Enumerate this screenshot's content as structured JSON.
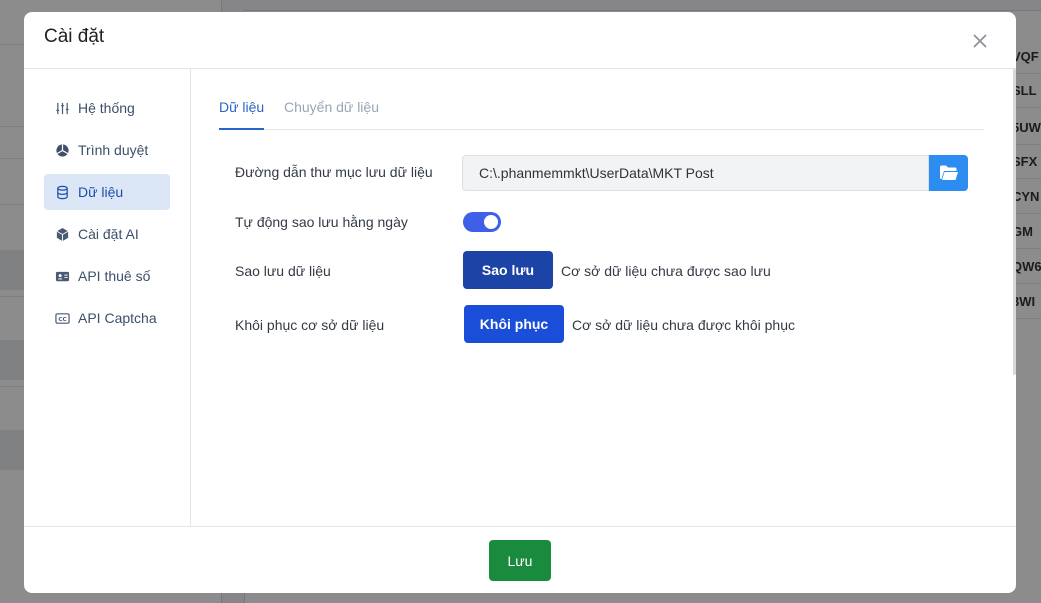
{
  "background": {
    "table_cells": [
      "VQF",
      "SLL",
      "5UW",
      "SFX",
      "CYN",
      "GM",
      "QW6",
      "3WI"
    ]
  },
  "modal": {
    "title": "Cài đặt",
    "close_icon": "close-icon"
  },
  "sidebar": {
    "items": [
      {
        "label": "Hệ thống",
        "icon": "sliders-icon"
      },
      {
        "label": "Trình duyệt",
        "icon": "browser-globe-icon"
      },
      {
        "label": "Dữ liệu",
        "icon": "database-icon",
        "active": true
      },
      {
        "label": "Cài đặt AI",
        "icon": "ai-cube-icon"
      },
      {
        "label": "API thuê số",
        "icon": "id-card-icon"
      },
      {
        "label": "API Captcha",
        "icon": "captcha-cc-icon"
      }
    ]
  },
  "tabs": [
    {
      "label": "Dữ liệu",
      "active": true
    },
    {
      "label": "Chuyển dữ liệu",
      "active": false
    }
  ],
  "form": {
    "path_label": "Đường dẫn thư mục lưu dữ liệu",
    "path_value": "C:\\.phanmemmkt\\UserData\\MKT Post",
    "auto_backup_label": "Tự động sao lưu hằng ngày",
    "auto_backup_on": true,
    "backup_label": "Sao lưu dữ liệu",
    "backup_button": "Sao lưu",
    "backup_status": "Cơ sở dữ liệu chưa được sao lưu",
    "restore_label": "Khôi phục cơ sở dữ liệu",
    "restore_button": "Khôi phục",
    "restore_status": "Cơ sở dữ liệu chưa được khôi phục"
  },
  "footer": {
    "save_button": "Lưu"
  },
  "colors": {
    "accent": "#2a64c9",
    "backup_button": "#1c43a6",
    "restore_button": "#1b4ed8",
    "save_button": "#1a8a3e",
    "folder_button": "#2d8cf0",
    "toggle_on": "#3f5fe8"
  }
}
